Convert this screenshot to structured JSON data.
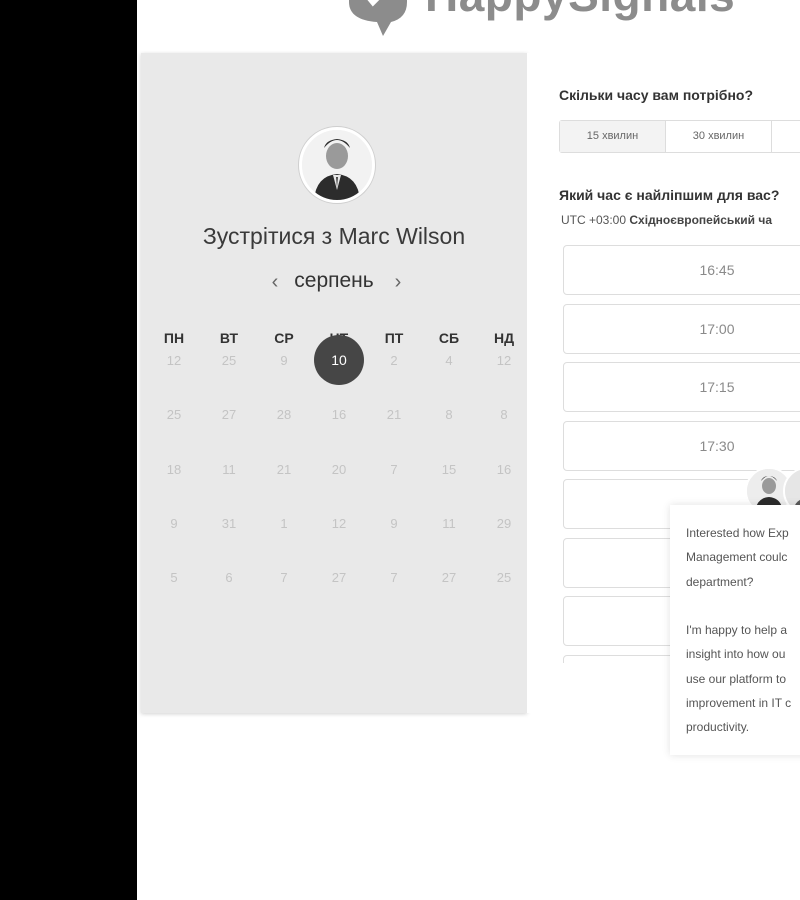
{
  "brand": {
    "name": "HappySignals"
  },
  "calendar": {
    "title": "Зустрітися з Marc Wilson",
    "month": "серпень",
    "prev_icon": "chevron-left-icon",
    "next_icon": "chevron-right-icon",
    "weekdays": [
      "ПН",
      "ВТ",
      "СР",
      "ЧТ",
      "ПТ",
      "СБ",
      "НД"
    ],
    "weeks": [
      [
        "12",
        "25",
        "9",
        "10",
        "2",
        "4",
        "12"
      ],
      [
        "25",
        "27",
        "28",
        "16",
        "21",
        "8",
        "8"
      ],
      [
        "18",
        "11",
        "21",
        "20",
        "7",
        "15",
        "16"
      ],
      [
        "9",
        "31",
        "1",
        "12",
        "9",
        "11",
        "29"
      ],
      [
        "5",
        "6",
        "7",
        "27",
        "7",
        "27",
        "25"
      ]
    ],
    "selected_day": "10"
  },
  "booking": {
    "duration_question": "Скільки часу вам потрібно?",
    "durations": [
      "15 хвилин",
      "30 хвилин",
      ""
    ],
    "active_duration": "15 хвилин",
    "time_question": "Який час є найліпшим для вас?",
    "timezone_offset": "UTC +03:00",
    "timezone_name": "Східноєвропейський ча",
    "slots": [
      "16:45",
      "17:00",
      "17:15",
      "17:30",
      "",
      "",
      "",
      ""
    ]
  },
  "chat": {
    "lines": [
      "Interested how Exp",
      "Management coulc",
      "department?",
      "",
      "I'm happy to help a",
      "insight into how ou",
      "use our platform to",
      "improvement in IT c",
      "productivity."
    ]
  }
}
